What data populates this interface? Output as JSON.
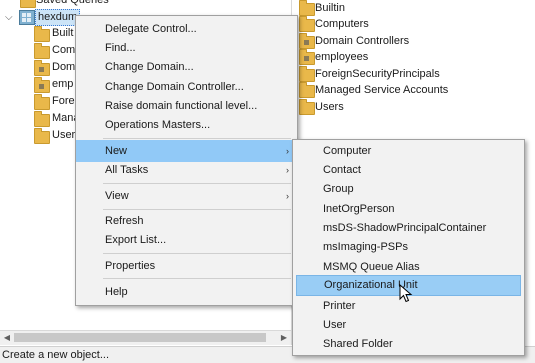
{
  "tree": {
    "items": [
      {
        "label": "Saved Queries"
      },
      {
        "label": "hexdum"
      },
      {
        "label": "Built"
      },
      {
        "label": "Com"
      },
      {
        "label": "Dom"
      },
      {
        "label": "emp"
      },
      {
        "label": "Forei"
      },
      {
        "label": "Mana"
      },
      {
        "label": "Users"
      }
    ],
    "expander": "⌵"
  },
  "list": {
    "items": [
      {
        "label": "Builtin"
      },
      {
        "label": "Computers"
      },
      {
        "label": "Domain Controllers"
      },
      {
        "label": "employees"
      },
      {
        "label": "ForeignSecurityPrincipals"
      },
      {
        "label": "Managed Service Accounts"
      },
      {
        "label": "Users"
      }
    ]
  },
  "context_menu": {
    "items": [
      {
        "label": "Delegate Control..."
      },
      {
        "label": "Find..."
      },
      {
        "label": "Change Domain..."
      },
      {
        "label": "Change Domain Controller..."
      },
      {
        "label": "Raise domain functional level..."
      },
      {
        "label": "Operations Masters..."
      },
      {
        "label": "New"
      },
      {
        "label": "All Tasks"
      },
      {
        "label": "View"
      },
      {
        "label": "Refresh"
      },
      {
        "label": "Export List..."
      },
      {
        "label": "Properties"
      },
      {
        "label": "Help"
      }
    ],
    "submenu_arrow": "›"
  },
  "new_submenu": {
    "items": [
      {
        "label": "Computer"
      },
      {
        "label": "Contact"
      },
      {
        "label": "Group"
      },
      {
        "label": "InetOrgPerson"
      },
      {
        "label": "msDS-ShadowPrincipalContainer"
      },
      {
        "label": "msImaging-PSPs"
      },
      {
        "label": "MSMQ Queue Alias"
      },
      {
        "label": "Organizational Unit"
      },
      {
        "label": "Printer"
      },
      {
        "label": "User"
      },
      {
        "label": "Shared Folder"
      }
    ]
  },
  "scrollbar": {
    "left_arrow": "◀",
    "right_arrow": "▶"
  },
  "status_bar": {
    "text": "Create a new object..."
  },
  "colors": {
    "highlight": "#91c9f7",
    "menu_bg": "#f2f2f2",
    "folder": "#e9b84a"
  }
}
